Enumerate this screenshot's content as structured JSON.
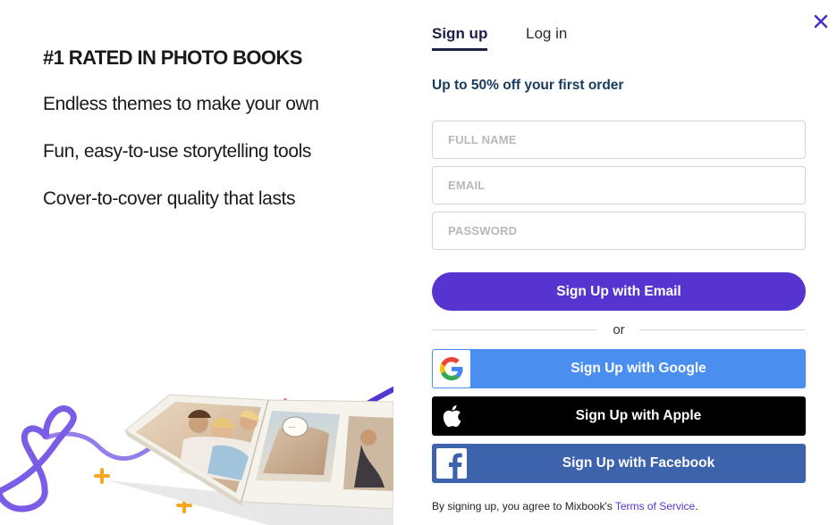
{
  "promo": {
    "title": "#1 RATED IN PHOTO BOOKS",
    "features": [
      "Endless themes to make your own",
      "Fun, easy-to-use storytelling tools",
      "Cover-to-cover quality that lasts"
    ]
  },
  "tabs": {
    "signup": "Sign up",
    "login": "Log in"
  },
  "offer": "Up to 50% off your first order",
  "form": {
    "full_name_placeholder": "FULL NAME",
    "email_placeholder": "EMAIL",
    "password_placeholder": "PASSWORD",
    "submit_label": "Sign Up with Email"
  },
  "divider_text": "or",
  "social": {
    "google_label": "Sign Up with Google",
    "apple_label": "Sign Up with Apple",
    "facebook_label": "Sign Up with Facebook"
  },
  "legal": {
    "prefix": "By signing up, you agree to Mixbook's",
    "link_text": "Terms of Service",
    "suffix": "."
  },
  "colors": {
    "primary": "#5634cf",
    "google": "#4a8ef0",
    "apple": "#000000",
    "facebook": "#3d63ad",
    "heading_navy": "#1c1f4a",
    "offer_blue": "#173a5e"
  },
  "icons": {
    "close": "close-icon",
    "google": "google-logo-icon",
    "apple": "apple-logo-icon",
    "facebook": "facebook-logo-icon"
  }
}
